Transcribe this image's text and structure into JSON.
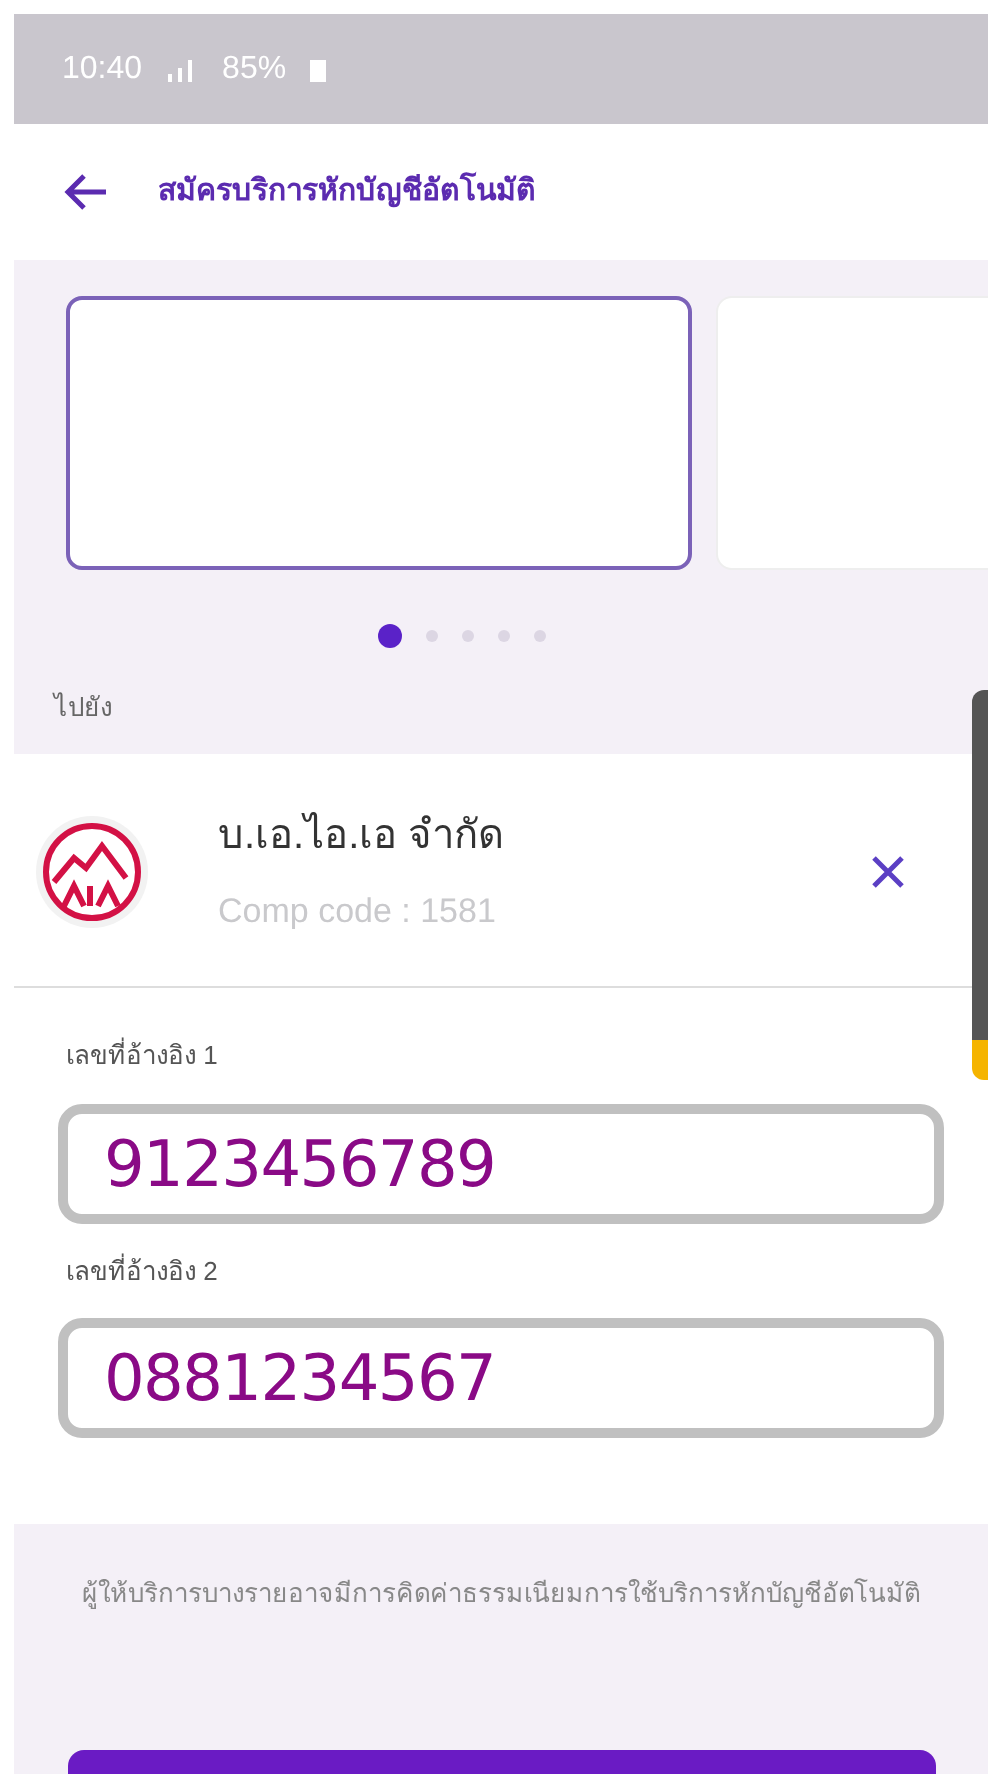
{
  "status_bar": {
    "time": "10:40",
    "battery": "85%"
  },
  "header": {
    "title": "สมัครบริการหักบัญชีอัตโนมัติ"
  },
  "carousel": {
    "cards": [
      {
        "selected": true
      },
      {
        "selected": false
      }
    ],
    "dots": [
      {
        "selected": true
      },
      {
        "selected": false
      },
      {
        "selected": false
      },
      {
        "selected": false
      },
      {
        "selected": false
      }
    ]
  },
  "destination": {
    "label": "ไปยัง",
    "company": "บ.เอ.ไอ.เอ จำกัด",
    "comp_code": "Comp code : 1581"
  },
  "fields": [
    {
      "label": "เลขที่อ้างอิง 1",
      "value": "9123456789"
    },
    {
      "label": "เลขที่อ้างอิง 2",
      "value": "0881234567"
    }
  ],
  "note": "ผู้ให้บริการบางรายอาจมีการคิดค่าธรรมเนียมการใช้บริการหักบัญชีอัตโนมัติ"
}
